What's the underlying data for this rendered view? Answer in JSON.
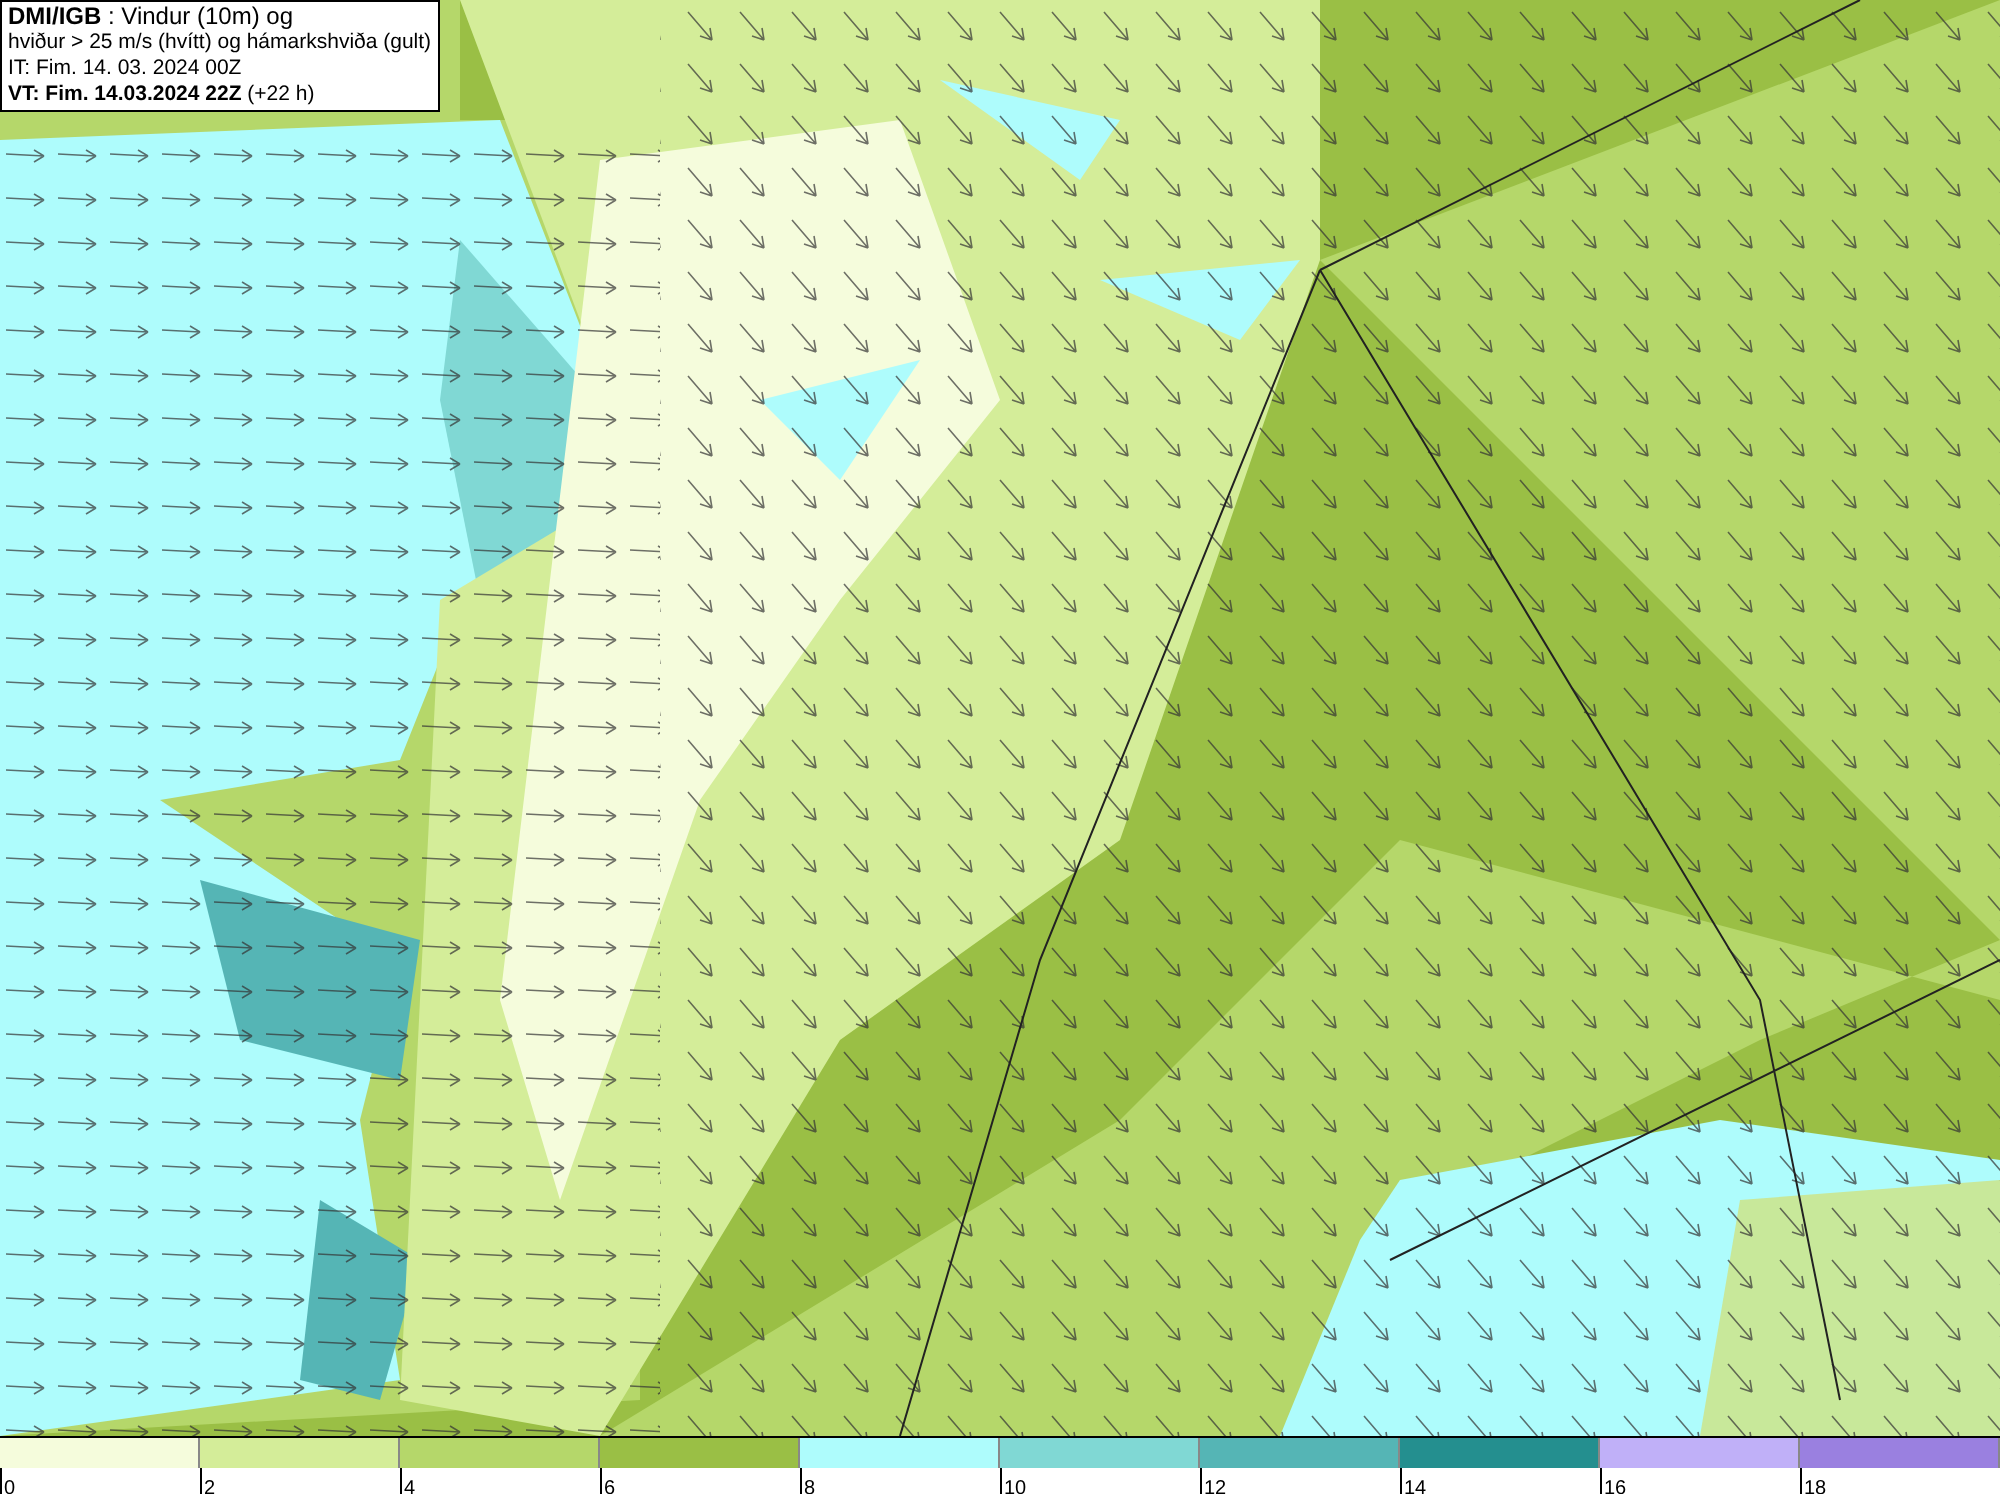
{
  "info_box": {
    "lines": [
      "**DMI/IGB** : Vindur (10m) og",
      "hviður > 25 m/s (hvítt) og hámarkshviða (gult)",
      "IT: Fim. 14. 03. 2024 00Z",
      "**VT: Fim. 14.03.2024 22Z** (+22 h)"
    ]
  },
  "legend": {
    "segments": [
      {
        "color": "#f5fcdc"
      },
      {
        "color": "#d4ed99"
      },
      {
        "color": "#b5d76a"
      },
      {
        "color": "#9abf45"
      },
      {
        "color": "#aefcfc"
      },
      {
        "color": "#80d8d4"
      },
      {
        "color": "#55b5b5"
      },
      {
        "color": "#248f8f"
      },
      {
        "color": "#c0b0f8"
      },
      {
        "color": "#9a80e0"
      }
    ],
    "ticks": [
      "0",
      "2",
      "4",
      "6",
      "8",
      "10",
      "12",
      "14",
      "16",
      "18"
    ]
  }
}
